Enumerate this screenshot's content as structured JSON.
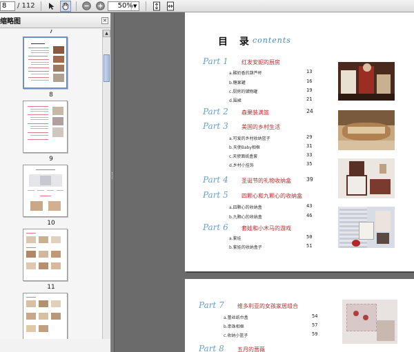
{
  "toolbar": {
    "page_current": "8",
    "page_total": "/ 112",
    "zoom": "50%"
  },
  "panel": {
    "title": "缩略图",
    "close": "×",
    "thumb_labels": [
      "7",
      "8",
      "9",
      "10",
      "11"
    ]
  },
  "toc": {
    "title": "目 录",
    "subtitle": "contents",
    "parts": [
      {
        "part": "Part 1",
        "title": "红发安妮的厨房",
        "page": "",
        "subs": [
          {
            "t": "a.酸奶香的葫芦杯",
            "p": "13"
          },
          {
            "t": "b.糖果罐",
            "p": "16"
          },
          {
            "t": "c.厨房的储物罐",
            "p": "19"
          },
          {
            "t": "d.围裙",
            "p": "21"
          }
        ]
      },
      {
        "part": "Part 2",
        "title": "森果装满篮",
        "page": "24",
        "subs": []
      },
      {
        "part": "Part 3",
        "title": "美国的乡村生活",
        "page": "",
        "subs": [
          {
            "t": "a.可爱的乡村收纳篮子",
            "p": "29"
          },
          {
            "t": "b.天使Baby相框",
            "p": "31"
          },
          {
            "t": "c.天使面纸盒套",
            "p": "33"
          },
          {
            "t": "d.乡村小挂饰",
            "p": "35"
          }
        ]
      },
      {
        "part": "Part 4",
        "title": "圣诞节的礼物收纳盒",
        "page": "39",
        "subs": []
      },
      {
        "part": "Part 5",
        "title": "四颗心和九颗心的收纳盒",
        "page": "",
        "subs": [
          {
            "t": "a.四颗心的收纳盒",
            "p": "43"
          },
          {
            "t": "b.九颗心的收纳盒",
            "p": "46"
          }
        ]
      },
      {
        "part": "Part 6",
        "title": "套娃和小木马的游戏",
        "page": "",
        "subs": [
          {
            "t": "a.套娃",
            "p": "50"
          },
          {
            "t": "b.套娃的收纳盒子",
            "p": "51"
          }
        ]
      }
    ],
    "page2": [
      {
        "part": "Part 7",
        "title": "维多利亚的女孩家居组合",
        "page": "",
        "subs": [
          {
            "t": "a.蕾丝纸巾盒",
            "p": "54"
          },
          {
            "t": "b.串珠相框",
            "p": "57"
          },
          {
            "t": "c.收纳小篮子",
            "p": "59"
          }
        ]
      },
      {
        "part": "Part 8",
        "title": "五月的蔷薇",
        "page": "",
        "subs": []
      }
    ]
  },
  "colors": {
    "part_label": "#6aa0c8",
    "part_title": "#b03030"
  }
}
